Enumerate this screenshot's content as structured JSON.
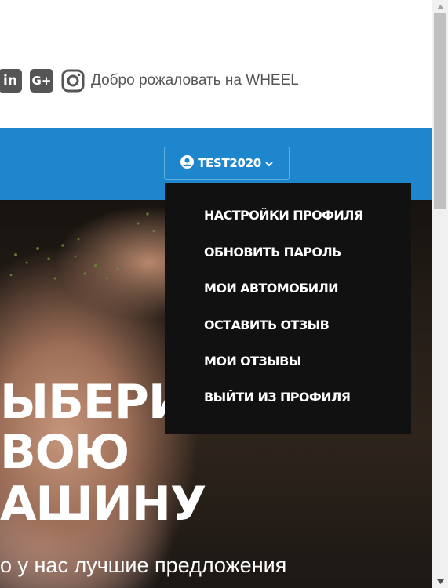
{
  "header": {
    "social_icons": [
      "linkedin-icon",
      "google-plus-icon",
      "instagram-icon"
    ],
    "linkedin_glyph": "in",
    "gplus_glyph": "G+",
    "welcome_text": "Добро рожаловать на WHEEL"
  },
  "nav": {
    "user_label": "TEST2020",
    "user_icon": "user-circle-icon",
    "caret_icon": "chevron-down-icon",
    "background_color": "#1e86cc"
  },
  "dropdown": {
    "items": [
      {
        "label": "НАСТРОЙКИ ПРОФИЛЯ"
      },
      {
        "label": "ОБНОВИТЬ ПАРОЛЬ"
      },
      {
        "label": "МОИ АВТОМОБИЛИ"
      },
      {
        "label": "ОСТАВИТЬ ОТЗЫВ"
      },
      {
        "label": "МОИ ОТЗЫВЫ"
      },
      {
        "label": "ВЫЙТИ ИЗ ПРОФИЛЯ"
      }
    ]
  },
  "hero": {
    "title_lines": [
      "ЫБЕРИ",
      "ВОЮ",
      "АШИНУ"
    ],
    "subtitle": "о у нас лучшие предложения"
  }
}
